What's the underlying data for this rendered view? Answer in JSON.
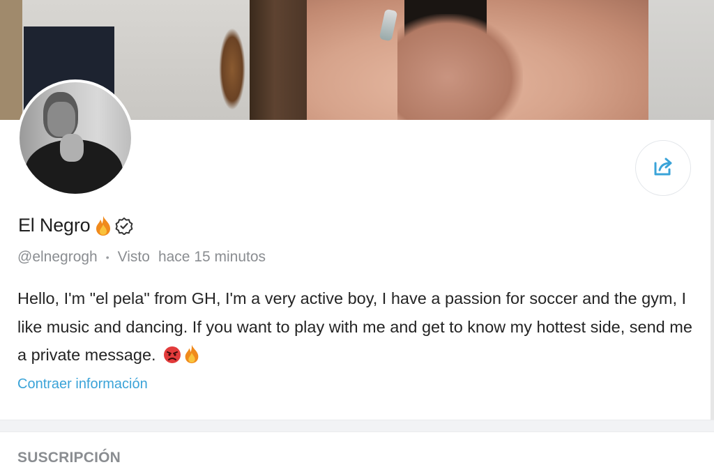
{
  "profile": {
    "name": "El Negro",
    "username": "@elnegrogh",
    "seen_label": "Visto",
    "seen_time": "hace 15 minutos",
    "bio": "Hello, I'm \"el pela\" from GH, I'm a very active boy, I have a passion for soccer and the gym, I like music and dancing. If you want to play with me and get to know my hottest side, send me a private message.",
    "collapse_label": "Contraer información"
  },
  "section": {
    "title": "SUSCRIPCIÓN"
  },
  "icons": {
    "share": "share-icon",
    "verified": "verified-icon",
    "fire": "fire-emoji",
    "angry": "angry-face-emoji"
  },
  "colors": {
    "accent": "#3aa3d8",
    "muted": "#8a8d91",
    "text": "#242424",
    "divider_bg": "#f2f3f5"
  }
}
